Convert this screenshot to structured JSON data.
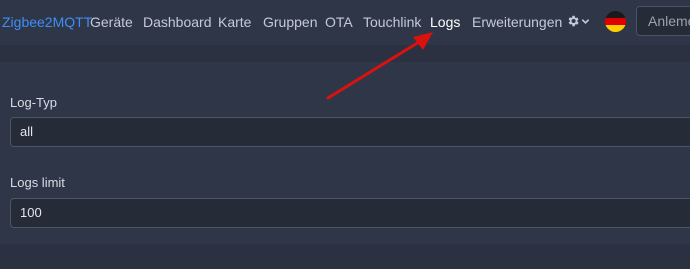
{
  "navbar": {
    "brand": "Zigbee2MQTT",
    "links": [
      "Geräte",
      "Dashboard",
      "Karte",
      "Gruppen",
      "OTA",
      "Touchlink",
      "Logs",
      "Erweiterungen"
    ],
    "active_link": "Logs",
    "search_placeholder": "Anlemen"
  },
  "form": {
    "log_type": {
      "label": "Log-Typ",
      "value": "all"
    },
    "logs_limit": {
      "label": "Logs limit",
      "value": "100"
    }
  },
  "colors": {
    "brand": "#3e8ef7",
    "arrow": "#d9120f",
    "background": "#2b3141",
    "panel": "#2f3647"
  },
  "icons": [
    "gear-icon",
    "chevron-down-icon",
    "german-flag-icon",
    "arrow-annotation"
  ]
}
